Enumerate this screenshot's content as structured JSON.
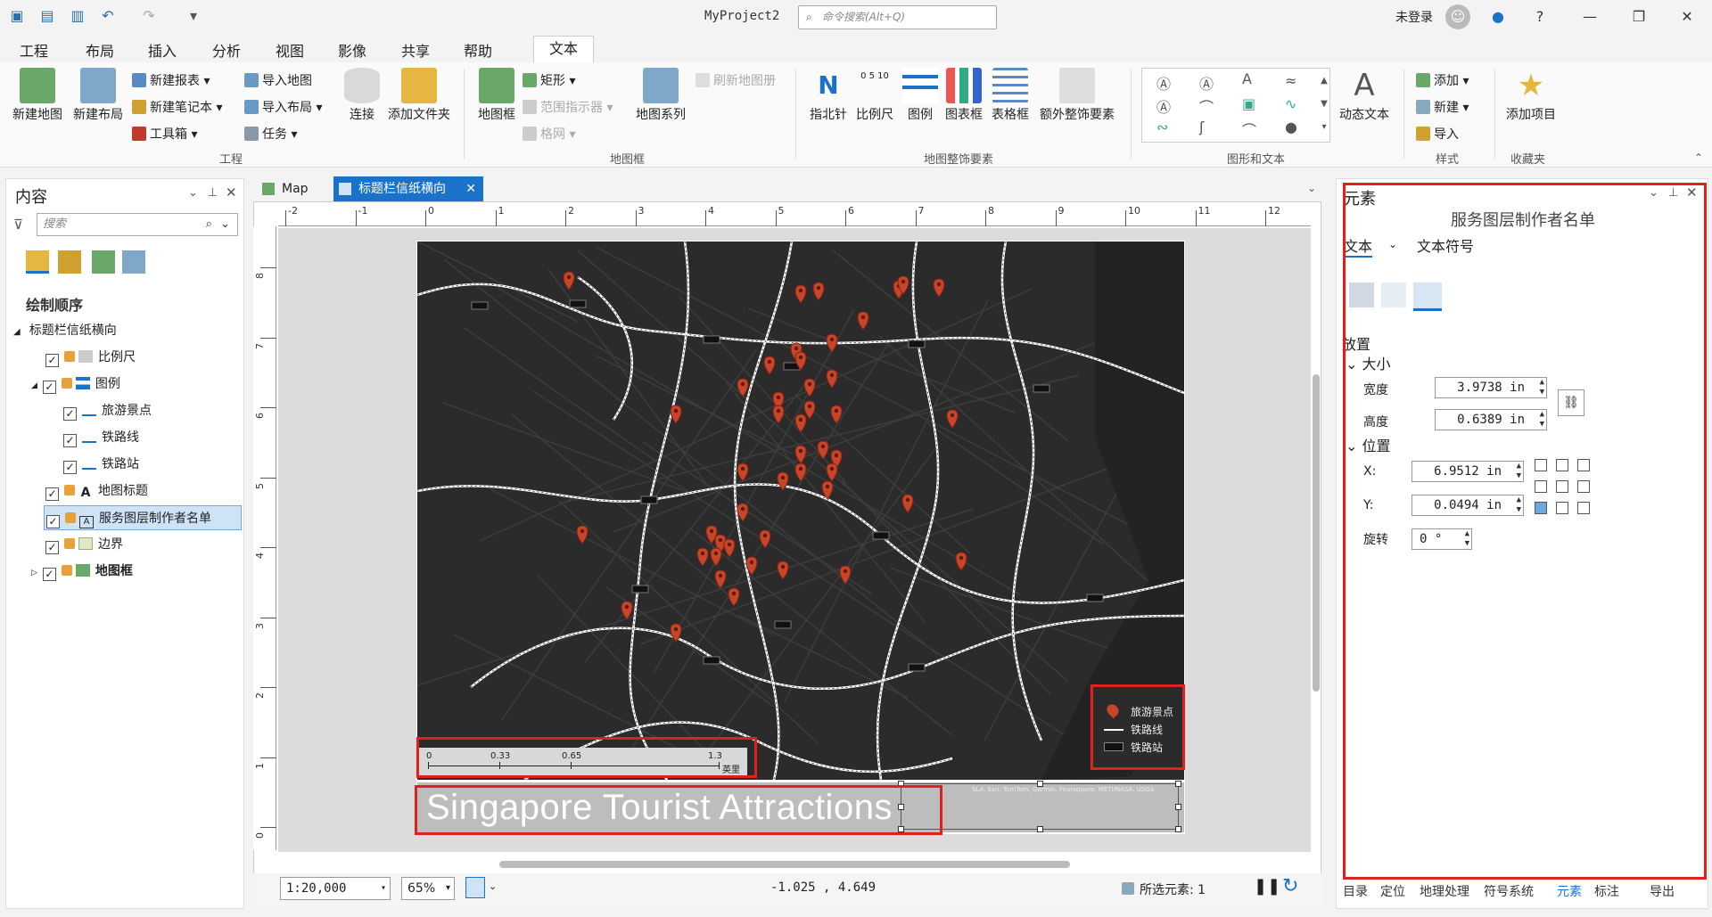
{
  "app": {
    "title": "MyProject2",
    "command_search_placeholder": "命令搜索(Alt+Q)",
    "login": "未登录"
  },
  "menu": [
    "工程",
    "布局",
    "插入",
    "分析",
    "视图",
    "影像",
    "共享",
    "帮助",
    "文本"
  ],
  "ribbon": {
    "groups": {
      "project": "工程",
      "map_frame": "地图框",
      "map_surround": "地图整饰要素",
      "graphics_text": "图形和文本",
      "styles": "样式",
      "favorites": "收藏夹"
    },
    "new_map": "新建地图",
    "new_layout": "新建布局",
    "new_report": "新建报表",
    "new_notebook": "新建笔记本",
    "toolbox": "工具箱",
    "import_map": "导入地图",
    "import_layout": "导入布局",
    "task": "任务",
    "connect": "连接",
    "add_folder": "添加文件夹",
    "map_frame": "地图框",
    "rectangle": "矩形",
    "extent_indicator": "范围指示器",
    "grid": "格网",
    "map_series": "地图系列",
    "refresh_map_series": "刷新地图册",
    "north_arrow": "指北针",
    "scale_bar": "比例尺",
    "legend": "图例",
    "chart_frame": "图表框",
    "table_frame": "表格框",
    "more_surround": "额外整饰要素",
    "dynamic_text": "动态文本",
    "add": "添加",
    "new": "新建",
    "import": "导入",
    "add_item": "添加项目",
    "scale_bar_icon_text": "0 5 10"
  },
  "contents": {
    "title": "内容",
    "search_placeholder": "搜索",
    "draw_order": "绘制顺序",
    "layout_name": "标题栏信纸横向",
    "items": [
      {
        "label": "比例尺",
        "checked": true,
        "level": 1
      },
      {
        "label": "图例",
        "checked": true,
        "level": 1
      },
      {
        "label": "旅游景点",
        "checked": true,
        "level": 2
      },
      {
        "label": "铁路线",
        "checked": true,
        "level": 2
      },
      {
        "label": "铁路站",
        "checked": true,
        "level": 2
      },
      {
        "label": "地图标题",
        "checked": true,
        "level": 1
      },
      {
        "label": "服务图层制作者名单",
        "checked": true,
        "level": 1,
        "selected": true
      },
      {
        "label": "边界",
        "checked": true,
        "level": 1
      },
      {
        "label": "地图框",
        "checked": true,
        "level": 1
      }
    ]
  },
  "view_tabs": [
    {
      "label": "Map",
      "active": false
    },
    {
      "label": "标题栏信纸横向",
      "active": true
    }
  ],
  "rulers": {
    "h": [
      "-2",
      "-1",
      "0",
      "1",
      "2",
      "3",
      "4",
      "5",
      "6",
      "7",
      "8",
      "9",
      "10",
      "11",
      "12"
    ],
    "v": [
      "8",
      "7",
      "6",
      "5",
      "4",
      "3",
      "2",
      "1",
      "0"
    ]
  },
  "layout": {
    "map_title": "Singapore Tourist Attractions",
    "credits": "SLA, Esri, TomTom, Garmin, Foursquare, METI/NASA, USGS",
    "legend": {
      "points": "旅游景点",
      "lines": "铁路线",
      "stations": "铁路站"
    },
    "scalebar": {
      "ticks": [
        "0",
        "0.33",
        "0.65",
        "1.3"
      ],
      "unit": "英里"
    }
  },
  "status": {
    "scale": "1:20,000",
    "zoom": "65%",
    "coords": "-1.025 , 4.649",
    "selected": "所选元素: 1"
  },
  "element_pane": {
    "title": "元素",
    "subtitle": "服务图层制作者名单",
    "tab_text": "文本",
    "tab_symbol": "文本符号",
    "placement": "放置",
    "size": "大小",
    "width_label": "宽度",
    "width_value": "3.9738 in",
    "height_label": "高度",
    "height_value": "0.6389 in",
    "position": "位置",
    "x_label": "X:",
    "x_value": "6.9512 in",
    "y_label": "Y:",
    "y_value": "0.0494 in",
    "rotation_label": "旋转",
    "rotation_value": "0 °"
  },
  "bottom_tabs": [
    "目录",
    "定位",
    "地理处理",
    "符号系统",
    "元素",
    "标注",
    "导出"
  ],
  "colors": {
    "accent": "#1a73c8",
    "highlight": "#e0201b",
    "map_bg": "#2b2b2b",
    "poi": "#c8452a"
  }
}
